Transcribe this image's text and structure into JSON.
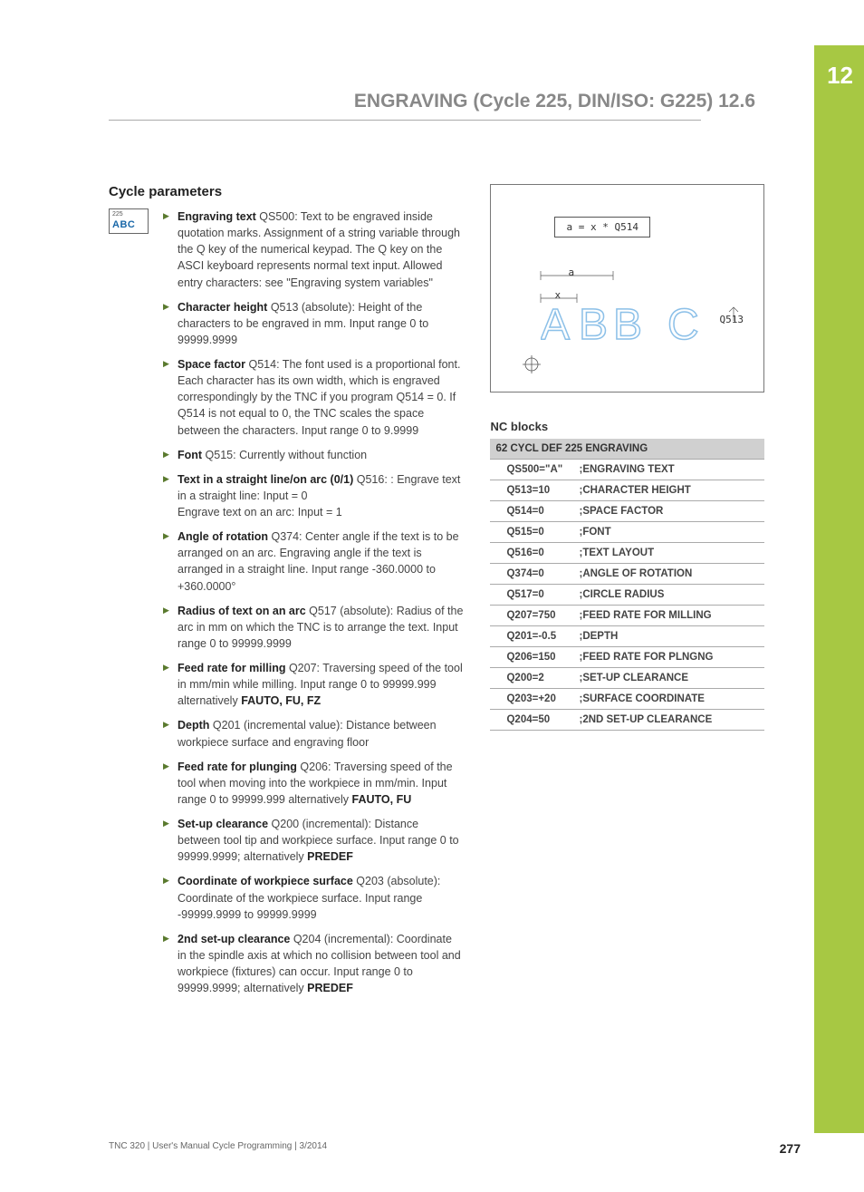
{
  "chapter_number": "12",
  "header": {
    "title": "ENGRAVING (Cycle 225, DIN/ISO: G225)   12.6"
  },
  "section_title": "Cycle parameters",
  "icon": {
    "num": "225",
    "text": "ABC"
  },
  "params": [
    {
      "label": "Engraving text",
      "code": "QS500",
      "desc": ": Text to be engraved inside quotation marks. Assignment of a string variable through the Q key of the numerical keypad. The Q key on the ASCI keyboard represents normal text input. Allowed entry characters: see \"Engraving system variables\""
    },
    {
      "label": "Character height",
      "code": "Q513",
      "desc": " (absolute): Height of the characters to be engraved in mm. Input range 0 to 99999.9999"
    },
    {
      "label": "Space factor",
      "code": "Q514",
      "desc": ": The font used is a proportional font. Each character has its own width, which is engraved correspondingly by the TNC if you program Q514 = 0. If Q514 is not equal to 0, the TNC scales the space between the characters. Input range 0 to 9.9999"
    },
    {
      "label": "Font",
      "code": "Q515",
      "desc": ": Currently without function"
    },
    {
      "label": "Text in a straight line/on arc (0/1)",
      "code": "Q516",
      "desc": ": Engrave text in a straight line: Input = 0\nEngrave text on an arc: Input = 1"
    },
    {
      "label": "Angle of rotation",
      "code": "Q374",
      "desc": ": Center angle if the text is to be arranged on an arc. Engraving angle if the text is arranged in a straight line. Input range -360.0000 to +360.0000°"
    },
    {
      "label": "Radius of text on an arc",
      "code": "Q517",
      "desc": " (absolute): Radius of the arc in mm on which the TNC is to arrange the text. Input range 0 to 99999.9999"
    },
    {
      "label": "Feed rate for milling",
      "code": "Q207",
      "desc": ": Traversing speed of the tool in mm/min while milling. Input range 0 to 99999.999 alternatively ",
      "suffix_bold": "FAUTO, FU, FZ"
    },
    {
      "label": "Depth",
      "code": "Q201",
      "desc": " (incremental value): Distance between workpiece surface and engraving floor"
    },
    {
      "label": "Feed rate for plunging",
      "code": "Q206",
      "desc": ": Traversing speed of the tool when moving into the workpiece in mm/min. Input range 0 to 99999.999 alternatively ",
      "suffix_bold": "FAUTO, FU"
    },
    {
      "label": "Set-up clearance",
      "code": "Q200",
      "desc": " (incremental): Distance between tool tip and workpiece surface. Input range 0 to 99999.9999; alternatively ",
      "suffix_bold": "PREDEF"
    },
    {
      "label": "Coordinate of workpiece surface",
      "code": "Q203",
      "desc": " (absolute): Coordinate of the workpiece surface. Input range -99999.9999 to 99999.9999"
    },
    {
      "label": "2nd set-up clearance",
      "code": "Q204",
      "desc": " (incremental): Coordinate in the spindle axis at which no collision between tool and workpiece (fixtures) can occur. Input range 0 to 99999.9999; alternatively ",
      "suffix_bold": "PREDEF"
    }
  ],
  "diagram": {
    "formula": "a = x * Q514",
    "dim_a": "a",
    "dim_x": "x",
    "dim_h": "Q513",
    "letters": "ABB C"
  },
  "nc_title": "NC blocks",
  "nc_header": "62 CYCL DEF 225 ENGRAVING",
  "nc_rows": [
    {
      "param": "QS500=\"A\"",
      "desc": ";ENGRAVING TEXT"
    },
    {
      "param": "Q513=10",
      "desc": ";CHARACTER HEIGHT"
    },
    {
      "param": "Q514=0",
      "desc": ";SPACE FACTOR"
    },
    {
      "param": "Q515=0",
      "desc": ";FONT"
    },
    {
      "param": "Q516=0",
      "desc": ";TEXT LAYOUT"
    },
    {
      "param": "Q374=0",
      "desc": ";ANGLE OF ROTATION"
    },
    {
      "param": "Q517=0",
      "desc": ";CIRCLE RADIUS"
    },
    {
      "param": "Q207=750",
      "desc": ";FEED RATE FOR MILLING"
    },
    {
      "param": "Q201=-0.5",
      "desc": ";DEPTH"
    },
    {
      "param": "Q206=150",
      "desc": ";FEED RATE FOR PLNGNG"
    },
    {
      "param": "Q200=2",
      "desc": ";SET-UP CLEARANCE"
    },
    {
      "param": "Q203=+20",
      "desc": ";SURFACE COORDINATE"
    },
    {
      "param": "Q204=50",
      "desc": ";2ND SET-UP CLEARANCE"
    }
  ],
  "footer": {
    "left": "TNC 320 | User's Manual Cycle Programming | 3/2014",
    "page": "277"
  }
}
